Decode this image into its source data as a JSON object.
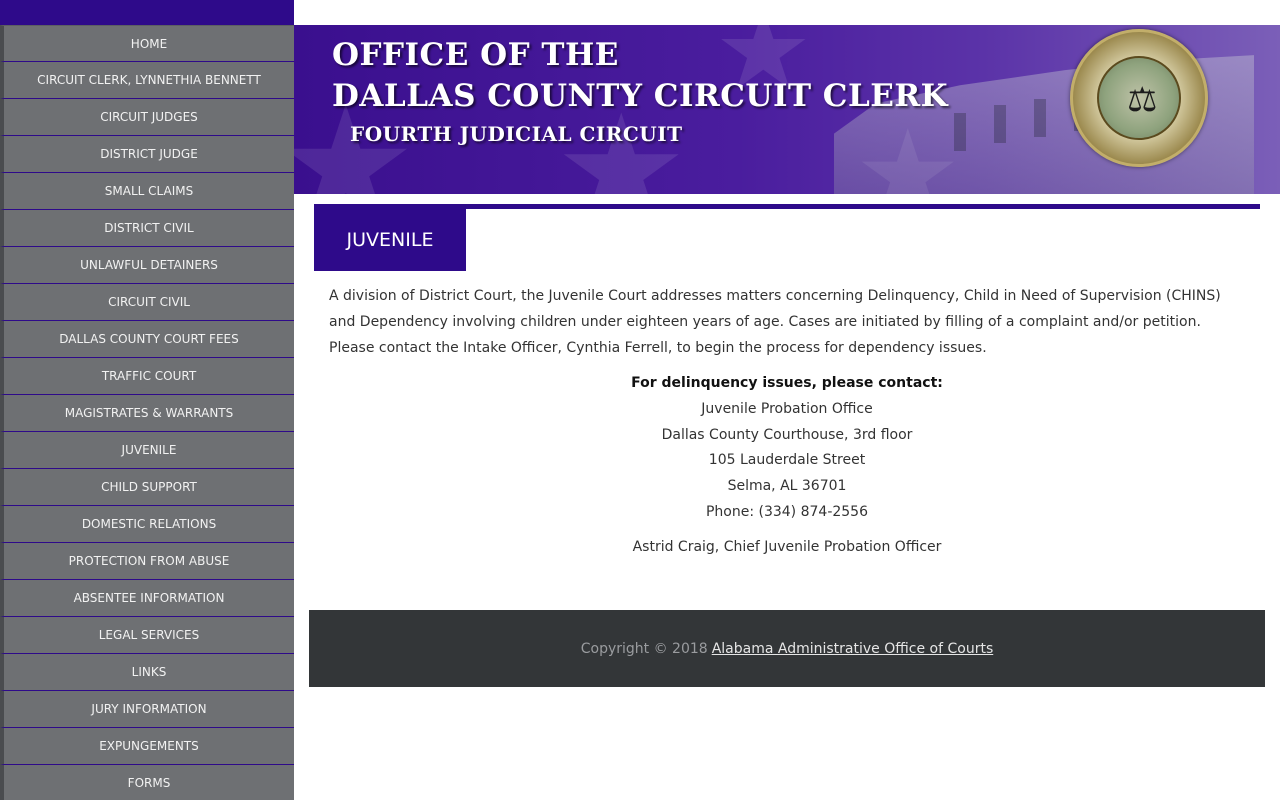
{
  "sidebar": {
    "items": [
      {
        "label": "HOME"
      },
      {
        "label": "CIRCUIT CLERK, LYNNETHIA BENNETT"
      },
      {
        "label": "CIRCUIT JUDGES"
      },
      {
        "label": "DISTRICT JUDGE"
      },
      {
        "label": "SMALL CLAIMS"
      },
      {
        "label": "DISTRICT CIVIL"
      },
      {
        "label": "UNLAWFUL DETAINERS"
      },
      {
        "label": "CIRCUIT CIVIL"
      },
      {
        "label": "DALLAS COUNTY COURT FEES"
      },
      {
        "label": "TRAFFIC COURT"
      },
      {
        "label": "MAGISTRATES & WARRANTS"
      },
      {
        "label": "JUVENILE"
      },
      {
        "label": "CHILD SUPPORT"
      },
      {
        "label": "DOMESTIC RELATIONS"
      },
      {
        "label": "PROTECTION FROM ABUSE"
      },
      {
        "label": "ABSENTEE INFORMATION"
      },
      {
        "label": "LEGAL SERVICES"
      },
      {
        "label": "LINKS"
      },
      {
        "label": "JURY INFORMATION"
      },
      {
        "label": "EXPUNGEMENTS"
      },
      {
        "label": "FORMS"
      }
    ]
  },
  "banner": {
    "line1": "OFFICE OF THE",
    "line2": "DALLAS COUNTY CIRCUIT CLERK",
    "line3": "FOURTH JUDICIAL CIRCUIT",
    "seal_icon": "alabama-unified-judicial-system-seal"
  },
  "content": {
    "section_title": "JUVENILE",
    "intro": "A division of District Court, the Juvenile Court addresses matters concerning Delinquency, Child in Need of Supervision (CHINS) and Dependency involving children under eighteen years of age. Cases are initiated by filling of a complaint and/or petition. Please contact the Intake Officer, Cynthia Ferrell, to begin the process for dependency issues.",
    "contact": {
      "heading": "For delinquency issues, please contact:",
      "office": "Juvenile Probation Office",
      "location": "Dallas County Courthouse, 3rd floor",
      "street": "105 Lauderdale Street",
      "city": "Selma, AL 36701",
      "phone": "Phone: (334) 874-2556"
    },
    "chief": "Astrid Craig, Chief Juvenile Probation Officer"
  },
  "footer": {
    "copyright": "Copyright © 2018",
    "link": "Alabama Administrative Office of Courts"
  },
  "colors": {
    "brand_purple": "#2e0a8a",
    "sidebar_gray": "#6e7073",
    "footer_dark": "#333638"
  }
}
